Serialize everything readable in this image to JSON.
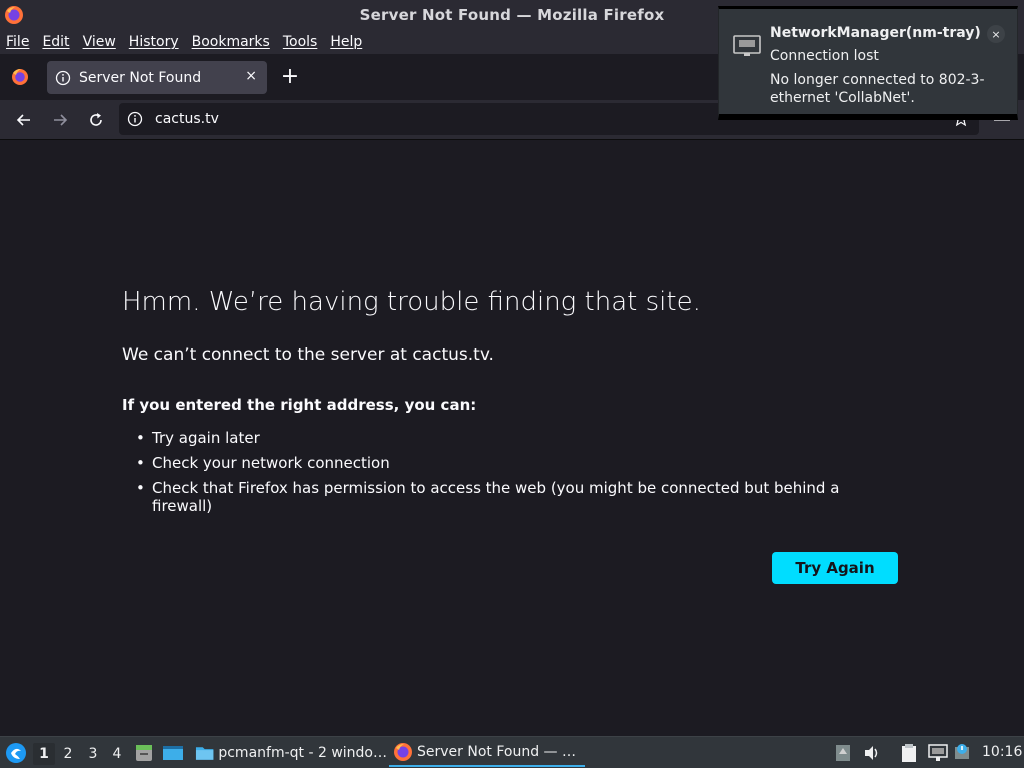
{
  "window": {
    "title": "Server Not Found — Mozilla Firefox"
  },
  "menubar": {
    "items": [
      "File",
      "Edit",
      "View",
      "History",
      "Bookmarks",
      "Tools",
      "Help"
    ]
  },
  "tab": {
    "label": "Server Not Found",
    "close": "×",
    "new_tab": "+"
  },
  "navbar": {
    "url": "cactus.tv"
  },
  "error": {
    "title": "Hmm. We’re having trouble finding that site.",
    "description": "We can’t connect to the server at cactus.tv.",
    "subtitle": "If you entered the right address, you can:",
    "suggestions": [
      "Try again later",
      "Check your network connection",
      "Check that Firefox has permission to access the web (you might be connected but behind a firewall)"
    ],
    "button": "Try Again"
  },
  "notification": {
    "app": "NetworkManager(nm-tray)",
    "summary": "Connection lost",
    "body": "No longer connected to 802-3-ethernet 'CollabNet'.",
    "close": "×"
  },
  "taskbar": {
    "desktops": [
      "1",
      "2",
      "3",
      "4"
    ],
    "active_desktop": "1",
    "tasks": [
      {
        "label": "pcmanfm-qt - 2 windo…",
        "icon": "folder-icon"
      },
      {
        "label": "Server Not Found — …",
        "icon": "firefox-icon"
      }
    ],
    "clock": "10:16"
  },
  "colors": {
    "accent": "#00ddff",
    "background": "#1c1b22",
    "toolbar": "#2b2a33",
    "taskbar": "#31363b"
  }
}
